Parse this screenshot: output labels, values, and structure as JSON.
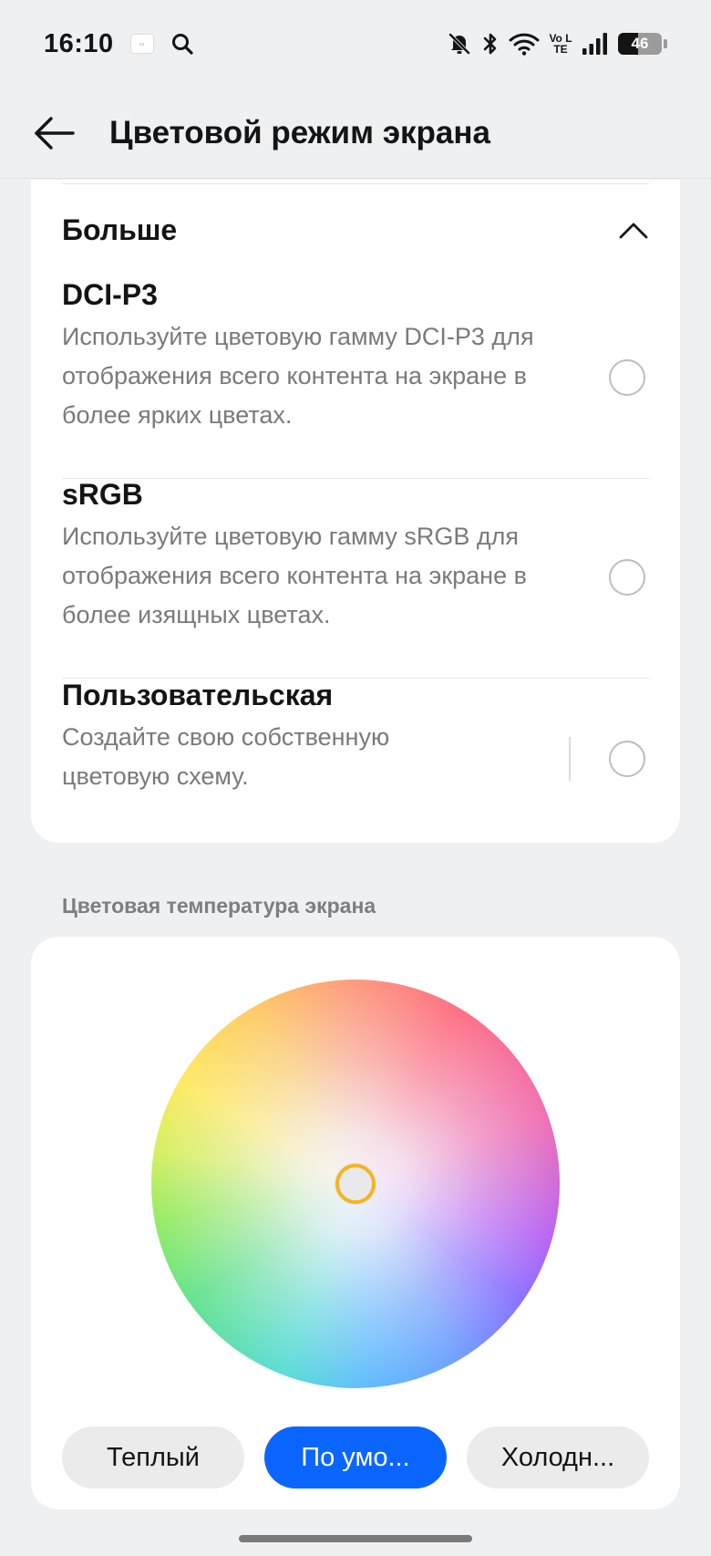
{
  "status_bar": {
    "time": "16:10",
    "battery_level": "46",
    "network_label": "Vo LTE",
    "icons": [
      "app-thumbnail-icon",
      "search-icon",
      "bell-off-icon",
      "bluetooth-icon",
      "wifi-icon",
      "signal-icon",
      "battery-icon"
    ]
  },
  "app_bar": {
    "title": "Цветовой режим экрана",
    "back_icon": "arrow-left-icon"
  },
  "more_section": {
    "label": "Больше",
    "expanded": true,
    "chevron_icon": "chevron-up-icon"
  },
  "options": [
    {
      "title": "DCI-P3",
      "description": "Используйте цветовую гамму DCI-P3 для отображения всего контента на экране в более ярких цветах.",
      "selected": false
    },
    {
      "title": "sRGB",
      "description": "Используйте цветовую гамму sRGB для отображения всего контента на экране в более изящных цветах.",
      "selected": false
    },
    {
      "title": "Пользовательская",
      "description": "Создайте свою собственную цветовую схему.",
      "selected": false
    }
  ],
  "color_temperature": {
    "section_label": "Цветовая температура экрана",
    "presets": [
      {
        "label": "Теплый",
        "active": false
      },
      {
        "label": "По умо...",
        "active": true
      },
      {
        "label": "Холодн...",
        "active": false
      }
    ],
    "knob_color": "#f6b41f"
  },
  "colors": {
    "accent": "#0a66ff",
    "background": "#eff0f2",
    "card": "#ffffff"
  }
}
